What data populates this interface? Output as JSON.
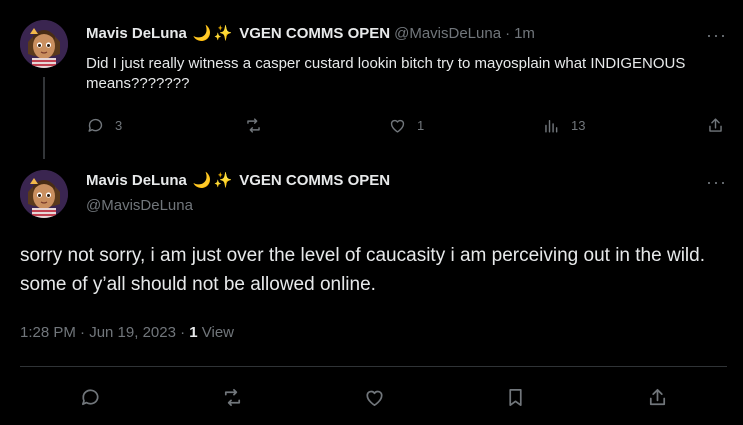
{
  "reply": {
    "display_name": "Mavis DeLuna",
    "emoji_moon": "🌙",
    "emoji_sparkles": "✨",
    "name_suffix": "VGEN COMMS OPEN",
    "handle": "@MavisDeLuna",
    "separator": "·",
    "time": "1m",
    "text": "Did I just really witness a casper custard lookin bitch try to mayosplain what INDIGENOUS means???????",
    "more": "···",
    "stats": {
      "replies": "3",
      "likes": "1",
      "views": "13"
    }
  },
  "main_post": {
    "display_name": "Mavis DeLuna",
    "emoji_moon": "🌙",
    "emoji_sparkles": "✨",
    "name_suffix": "VGEN COMMS OPEN",
    "handle": "@MavisDeLuna",
    "more": "···",
    "text": "sorry not sorry, i am just over the level of caucasity i am perceiving out in the wild. some of y’all should not be allowed online.",
    "timestamp": "1:28 PM · Jun 19, 2023 · ",
    "view_count": "1",
    "view_label": " View"
  },
  "colors": {
    "background": "#000000",
    "text": "#e7e9ea",
    "muted": "#71767b",
    "divider": "#2f3336"
  }
}
